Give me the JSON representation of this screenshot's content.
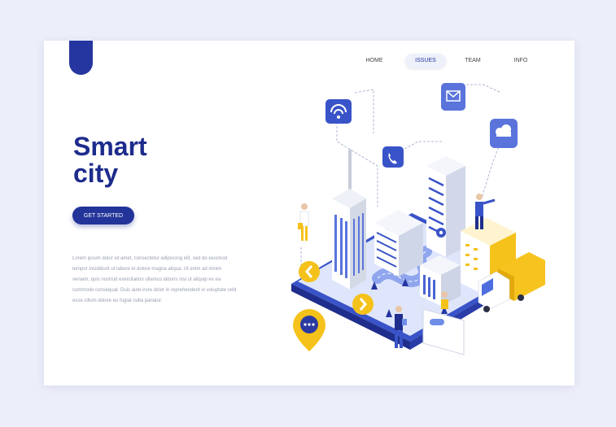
{
  "nav": {
    "items": [
      {
        "label": "HOME",
        "active": false
      },
      {
        "label": "ISSUES",
        "active": true
      },
      {
        "label": "TEAM",
        "active": false
      },
      {
        "label": "INFO",
        "active": false
      }
    ]
  },
  "hero": {
    "title_line1": "Smart",
    "title_line2": "city",
    "cta_label": "GET STARTED",
    "body_text": "Lorem ipsum dolor sit amet, consectetur adipiscing elit, sed do eiusmod tempor incididunt ut labore et dolore magna aliqua. Ut enim ad minim veniam, quis nostrud exercitation ullamco laboris nisi ut aliquip ex ea commodo consequat. Duis aute irure dolor in reprehenderit in voluptate velit esse cillum dolore eu fugiat nulla pariatur."
  },
  "colors": {
    "brand_blue": "#223399",
    "accent_yellow": "#f5c21b",
    "light_blue": "#6f8ee8",
    "page_bg": "#eceef9"
  },
  "illustration": {
    "icons": [
      "wifi-icon",
      "phone-icon",
      "mail-icon",
      "cloud-icon",
      "gear-icon",
      "chat-icon",
      "chevron-left-icon",
      "chevron-right-icon",
      "map-pin-icon"
    ]
  }
}
